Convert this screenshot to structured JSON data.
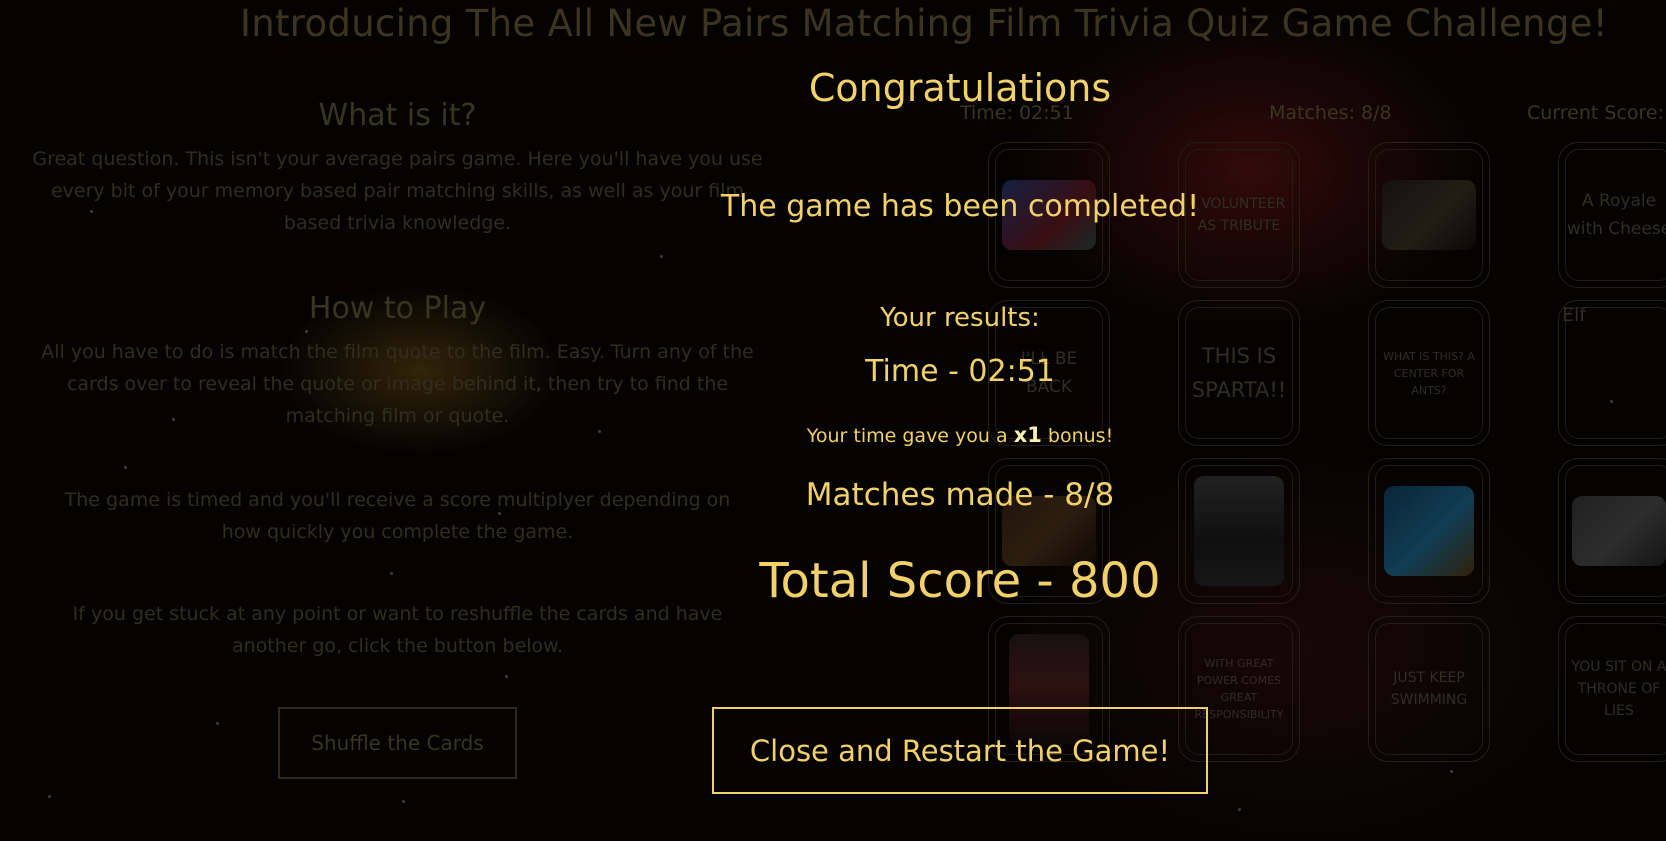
{
  "page": {
    "title": "Introducing The All New Pairs Matching Film Trivia Quiz Game Challenge!"
  },
  "info": {
    "what_heading": "What is it?",
    "what_text": "Great question. This isn't your average pairs game. Here you'll have you use every bit of your memory based pair matching skills, as well as your film based trivia knowledge.",
    "how_heading": "How to Play",
    "how_text": "All you have to do is match the film quote to the film. Easy. Turn any of the cards over to reveal the quote or image behind it, then try to find the matching film or quote.",
    "timed_text": "The game is timed and you'll receive a score multiplyer depending on how quickly you complete the game.",
    "stuck_text": "If you get stuck at any point or want to reshuffle the cards and have another go, click the button below.",
    "shuffle_label": "Shuffle the Cards"
  },
  "stats": {
    "time": "Time: 02:51",
    "matches": "Matches: 8/8",
    "score": "Current Score:"
  },
  "cards": [
    {
      "kind": "image",
      "icon": "spiderman-image"
    },
    {
      "kind": "text",
      "text": "I VOLUNTEER AS TRIBUTE"
    },
    {
      "kind": "image",
      "icon": "pulp-fiction-image"
    },
    {
      "kind": "text",
      "text": "A Royale with Cheese"
    },
    {
      "kind": "text",
      "text": "I'LL BE BACK"
    },
    {
      "kind": "text",
      "text": "THIS IS SPARTA!!"
    },
    {
      "kind": "text",
      "text": "WHAT IS THIS? A CENTER FOR ANTS?"
    },
    {
      "kind": "alt",
      "text": "Elf"
    },
    {
      "kind": "image",
      "icon": "300-image"
    },
    {
      "kind": "image",
      "icon": "hunger-games-image"
    },
    {
      "kind": "image",
      "icon": "finding-nemo-image"
    },
    {
      "kind": "image",
      "icon": "zoolander-image"
    },
    {
      "kind": "image",
      "icon": "terminator-image"
    },
    {
      "kind": "text",
      "text": "WITH GREAT POWER COMES GREAT RESPONSIBILITY"
    },
    {
      "kind": "text",
      "text": "JUST KEEP SWIMMING"
    },
    {
      "kind": "text",
      "text": "YOU SIT ON A THRONE OF LIES"
    }
  ],
  "modal": {
    "heading": "Congratulations",
    "completed": "The game has been completed!",
    "results_label": "Your results:",
    "time": "Time - 02:51",
    "bonus_prefix": "Your time gave you a",
    "bonus_value": "x1",
    "bonus_suffix": "bonus!",
    "matches": "Matches made - 8/8",
    "total": "Total Score - 800",
    "close_label": "Close and Restart the Game!"
  },
  "colors": {
    "accent": "#f2d06a",
    "background": "#000000"
  }
}
